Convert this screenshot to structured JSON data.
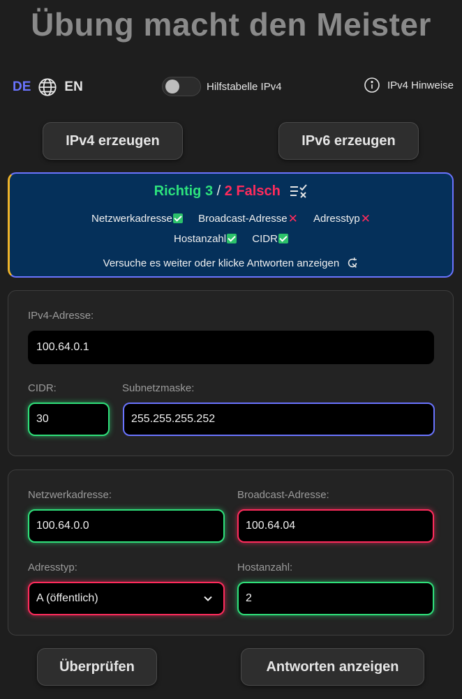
{
  "title": "Übung macht den Meister",
  "lang": {
    "de": "DE",
    "en": "EN"
  },
  "toggle_label": "Hilfstabelle IPv4",
  "hint_label": "IPv4 Hinweise",
  "buttons": {
    "ipv4": "IPv4 erzeugen",
    "ipv6": "IPv6 erzeugen",
    "check": "Überprüfen",
    "answers": "Antworten anzeigen"
  },
  "result": {
    "correct": "Richtig 3",
    "separator": " / ",
    "wrong": "2 Falsch",
    "items": [
      {
        "label": "Netzwerkadresse",
        "status": "correct"
      },
      {
        "label": "Broadcast-Adresse",
        "status": "wrong"
      },
      {
        "label": "Adresstyp",
        "status": "wrong"
      },
      {
        "label": "Hostanzahl",
        "status": "correct"
      },
      {
        "label": "CIDR",
        "status": "correct"
      }
    ],
    "message": "Versuche es weiter oder klicke Antworten anzeigen"
  },
  "form": {
    "ipv4_label": "IPv4-Adresse:",
    "ipv4_value": "100.64.0.1",
    "cidr_label": "CIDR:",
    "cidr_value": "30",
    "mask_label": "Subnetzmaske:",
    "mask_value": "255.255.255.252",
    "network_label": "Netzwerkadresse:",
    "network_value": "100.64.0.0",
    "broadcast_label": "Broadcast-Adresse:",
    "broadcast_value": "100.64.04",
    "type_label": "Adresstyp:",
    "type_value": "A (öffentlich)",
    "hosts_label": "Hostanzahl:",
    "hosts_value": "2"
  },
  "colors": {
    "correct": "#2de27d",
    "wrong": "#ff2b5c",
    "accent": "#6a74ff",
    "result_bg": "#05305a"
  }
}
